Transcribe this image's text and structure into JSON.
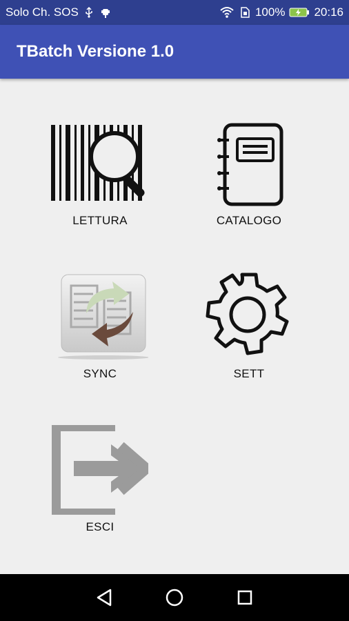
{
  "status_bar": {
    "carrier": "Solo Ch. SOS",
    "battery": "100%",
    "time": "20:16"
  },
  "app_bar": {
    "title": "TBatch Versione 1.0"
  },
  "tiles": [
    {
      "label": "LETTURA",
      "icon": "barcode-search-icon"
    },
    {
      "label": "CATALOGO",
      "icon": "notebook-icon"
    },
    {
      "label": "SYNC",
      "icon": "sync-icon"
    },
    {
      "label": "SETT",
      "icon": "gear-icon"
    },
    {
      "label": "ESCI",
      "icon": "exit-icon"
    }
  ],
  "nav": {
    "back": "back-icon",
    "home": "home-icon",
    "recents": "recents-icon"
  },
  "colors": {
    "status_bar": "#2e3f8f",
    "app_bar": "#3f51b5",
    "background": "#efefef",
    "battery_accent": "#8bc34a"
  }
}
